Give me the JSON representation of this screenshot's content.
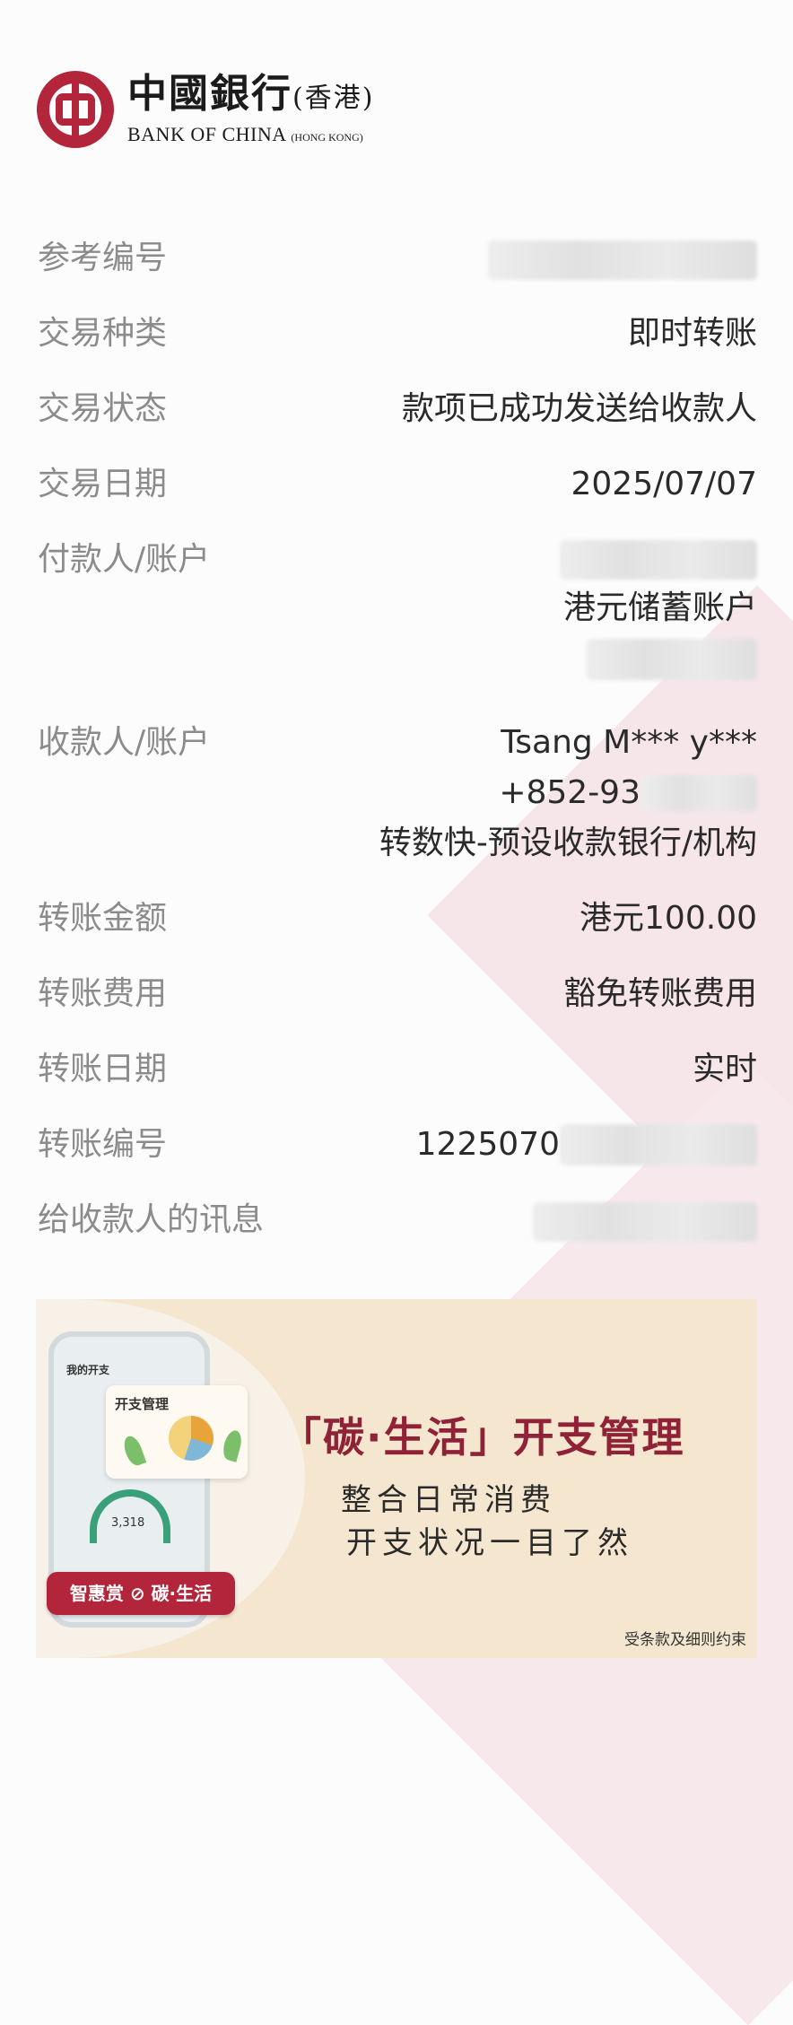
{
  "logo": {
    "cn_name": "中國銀行",
    "cn_region": "(香港)",
    "en_name": "BANK OF CHINA",
    "en_region": "(HONG KONG)"
  },
  "details": [
    {
      "label": "参考编号",
      "lines": []
    },
    {
      "label": "交易种类",
      "lines": [
        "即时转账"
      ]
    },
    {
      "label": "交易状态",
      "lines": [
        "款项已成功发送给收款人"
      ]
    },
    {
      "label": "交易日期",
      "lines": [
        "2025/07/07"
      ]
    },
    {
      "label": "付款人/账户",
      "lines": [
        "港元储蓄账户"
      ]
    },
    {
      "label": "收款人/账户",
      "lines": [
        "Tsang M*** y***",
        "+852-93",
        "转数快-预设收款银行/机构"
      ]
    },
    {
      "label": "转账金额",
      "lines": [
        "港元100.00"
      ]
    },
    {
      "label": "转账费用",
      "lines": [
        "豁免转账费用"
      ]
    },
    {
      "label": "转账日期",
      "lines": [
        "实时"
      ]
    },
    {
      "label": "转账编号",
      "lines": [
        "1225070"
      ]
    },
    {
      "label": "给收款人的讯息",
      "lines": []
    }
  ],
  "banner": {
    "headline": "「碳·生活」开支管理",
    "line1": "整合日常消费",
    "line2": "开支状况一目了然",
    "badge": "智惠赏 ⊘ 碳·生活",
    "terms": "受条款及细则约束",
    "phone_title": "我的开支",
    "phone_amount": "3,318",
    "card_title": "开支管理"
  },
  "colors": {
    "brand_red": "#b3253a",
    "headline": "#8f2237"
  }
}
